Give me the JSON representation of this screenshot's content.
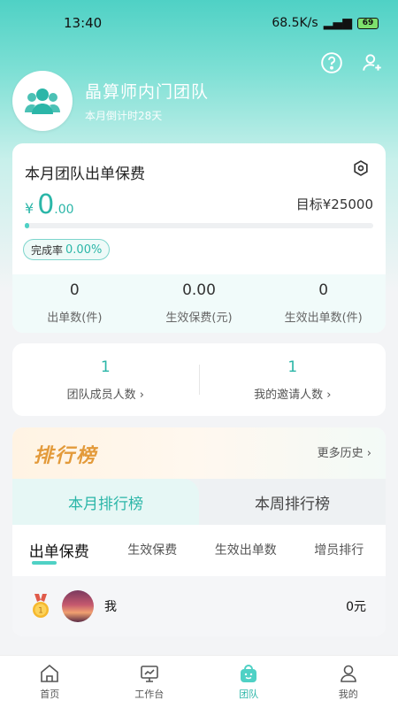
{
  "status_bar": {
    "time": "13:40",
    "network": "68.5K/s",
    "battery": "69"
  },
  "header": {
    "team_name": "晶算师内门团队",
    "countdown": "本月倒计时28天",
    "help_icon": "question-circle-icon",
    "add_member_icon": "person-add-icon"
  },
  "premium_card": {
    "title": "本月团队出单保费",
    "currency": "¥",
    "amount_int": "0",
    "amount_dec": ".00",
    "target_label": "目标¥25000",
    "progress_fraction": 0.0,
    "completion_label": "完成率",
    "completion_value": "0.00%",
    "stats": [
      {
        "value": "0",
        "label": "出单数(件)"
      },
      {
        "value": "0.00",
        "label": "生效保费(元)"
      },
      {
        "value": "0",
        "label": "生效出单数(件)"
      }
    ]
  },
  "members": {
    "team_count": "1",
    "team_label": "团队成员人数",
    "invite_count": "1",
    "invite_label": "我的邀请人数"
  },
  "leaderboard": {
    "title": "排行榜",
    "more_history": "更多历史",
    "period_tabs": [
      "本月排行榜",
      "本周排行榜"
    ],
    "metric_tabs": [
      "出单保费",
      "生效保费",
      "生效出单数",
      "增员排行"
    ],
    "rows": [
      {
        "rank": "1",
        "name": "我",
        "value": "0元"
      }
    ]
  },
  "bottom_nav": [
    {
      "label": "首页",
      "icon": "home-icon"
    },
    {
      "label": "工作台",
      "icon": "monitor-chart-icon"
    },
    {
      "label": "团队",
      "icon": "team-bag-icon"
    },
    {
      "label": "我的",
      "icon": "user-icon"
    }
  ],
  "colors": {
    "accent": "#2bb6a8",
    "hero": "#4fd1c5",
    "rank_title": "#e39a3a"
  }
}
